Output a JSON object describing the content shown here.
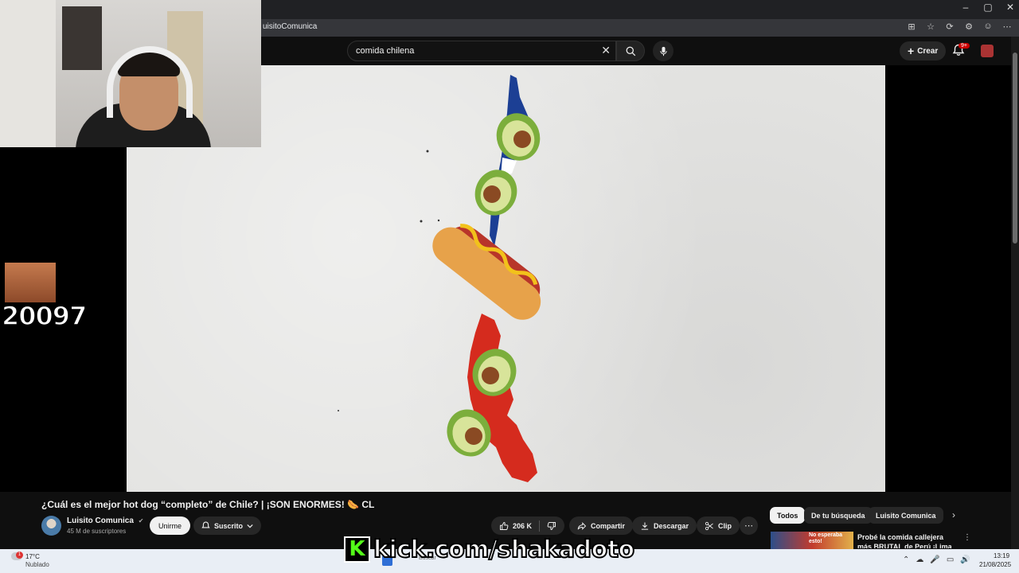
{
  "browser": {
    "url_fragment": "uisitoComunica",
    "window_controls": [
      "–",
      "▢",
      "✕"
    ],
    "extension_glyphs": [
      "⊞",
      "☆",
      "⟳",
      "⚙",
      "☺",
      "⋯"
    ]
  },
  "youtube": {
    "search": {
      "value": "comida chilena",
      "clear_glyph": "✕"
    },
    "create_label": "Crear",
    "notifications_badge": "9+"
  },
  "stream_overlay": {
    "viewer_count": "20097",
    "kick_logo": "K",
    "kick_url": "kick.com/shakadoto"
  },
  "video": {
    "title": "¿Cuál es el mejor hot dog “completo” de Chile? | ¡SON ENORMES! 🌭 CL",
    "channel": {
      "name": "Luisito Comunica",
      "subscribers": "45 M de suscriptores",
      "verified_glyph": "✔"
    },
    "join_label": "Unirme",
    "subscribed_label": "Suscrito",
    "likes": "206 K",
    "share_label": "Compartir",
    "download_label": "Descargar",
    "clip_label": "Clip",
    "more_glyph": "⋯"
  },
  "recommendations": {
    "chips": [
      "Todos",
      "De tu búsqueda",
      "Luisito Comunica"
    ],
    "next_glyph": "›",
    "first": {
      "title": "Probé la comida callejera más BRUTAL de Perú ¡Lima me...",
      "thumb_text": "No esperaba esto!",
      "kebab_glyph": "⋮"
    }
  },
  "taskbar": {
    "weather_badge": "1",
    "temperature": "17°C",
    "weather": "Nublado",
    "search_placeholder": "Buscar",
    "time": "13:19",
    "date": "21/08/2025",
    "tray_glyphs": [
      "⌃",
      "☁",
      "🎤",
      "▭",
      "🔊"
    ]
  },
  "colors": {
    "background": "#0f0f0f",
    "chile_blue": "#1c3f94",
    "chile_red": "#d52b1e",
    "kick_green": "#53fc18",
    "notification_red": "#cc0000"
  },
  "icons": {
    "search": "magnifier-icon",
    "mic": "microphone-icon",
    "bell": "bell-icon",
    "like": "thumbs-up-icon",
    "dislike": "thumbs-down-icon",
    "share": "share-arrow-icon",
    "download": "download-icon",
    "clip": "scissors-icon"
  }
}
